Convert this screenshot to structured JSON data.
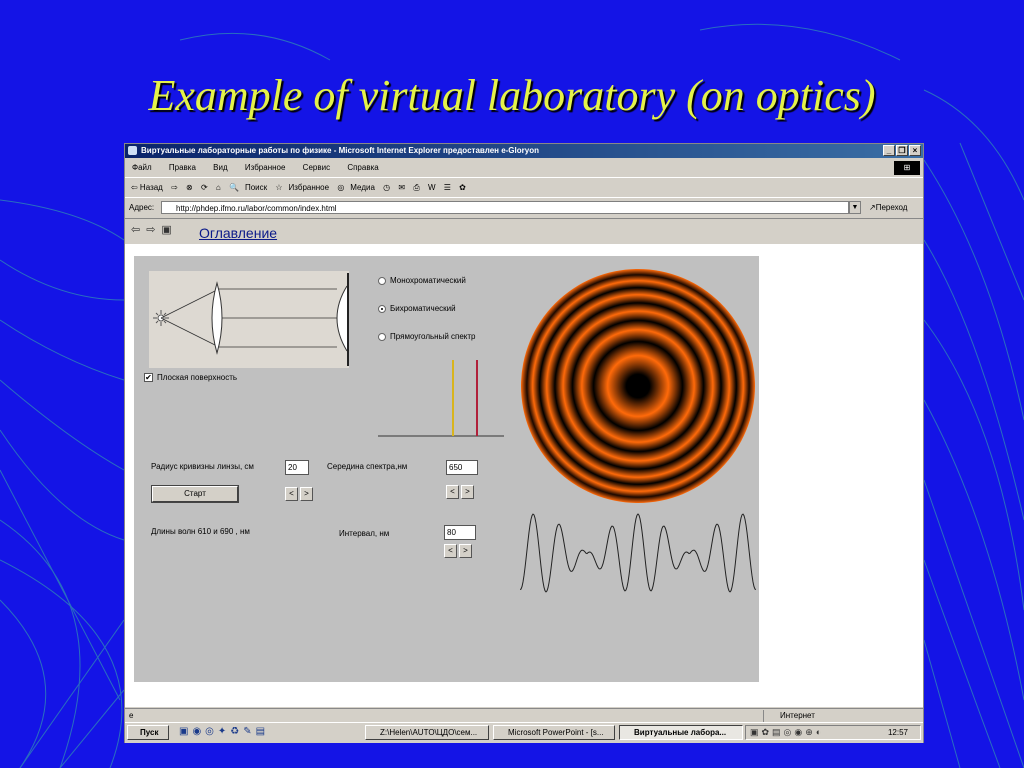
{
  "slide": {
    "title": "Example of virtual laboratory (on optics)",
    "bg_color": "#1414e6",
    "title_color": "#e4f24a"
  },
  "browser": {
    "title": "Виртуальные лабораторные работы по физике - Microsoft Internet Explorer предоставлен e-Gloryon",
    "window_buttons": [
      "_",
      "❐",
      "×"
    ],
    "menu": [
      "Файл",
      "Правка",
      "Вид",
      "Избранное",
      "Сервис",
      "Справка"
    ],
    "toolbar": {
      "back": "⇦ Назад",
      "forward": "⇨",
      "search": "Поиск",
      "favorites": "Избранное",
      "media": "Медиа"
    },
    "address_label": "Адрес:",
    "url": "http://phdep.ifmo.ru/labor/common/index.html",
    "go_label": "Переход",
    "toc_link": "Оглавление",
    "status_zone": "Интернет"
  },
  "lab": {
    "radio_options": [
      {
        "label": "Монохроматический",
        "selected": false
      },
      {
        "label": "Бихроматический",
        "selected": true
      },
      {
        "label": "Прямоугольный спектр",
        "selected": false
      }
    ],
    "flat_surface_label": "Плоская поверхность",
    "flat_surface_checked": true,
    "lens_radius_label": "Радиус кривизны линзы, см",
    "lens_radius_value": "20",
    "spectrum_center_label": "Середина спектра,нм",
    "spectrum_center_value": "650",
    "start_label": "Старт",
    "wavelengths_label": "Длины волн 610 и 690 , нм",
    "interval_label": "Интервал, нм",
    "interval_value": "80",
    "spin_left": "<",
    "spin_right": ">",
    "spectral_lines": [
      {
        "color": "#d9b41c"
      },
      {
        "color": "#b0203a"
      }
    ],
    "ring_colors": {
      "light": "#ff6a0a",
      "dark": "#000000"
    }
  },
  "taskbar": {
    "start": "Пуск",
    "tasks": [
      {
        "label": "Z:\\Helen\\AUTO\\ЦДО\\сем...",
        "active": false
      },
      {
        "label": "Microsoft PowerPoint - [s...",
        "active": false
      },
      {
        "label": "Виртуальные лабора...",
        "active": true
      }
    ],
    "clock": "12:57"
  }
}
